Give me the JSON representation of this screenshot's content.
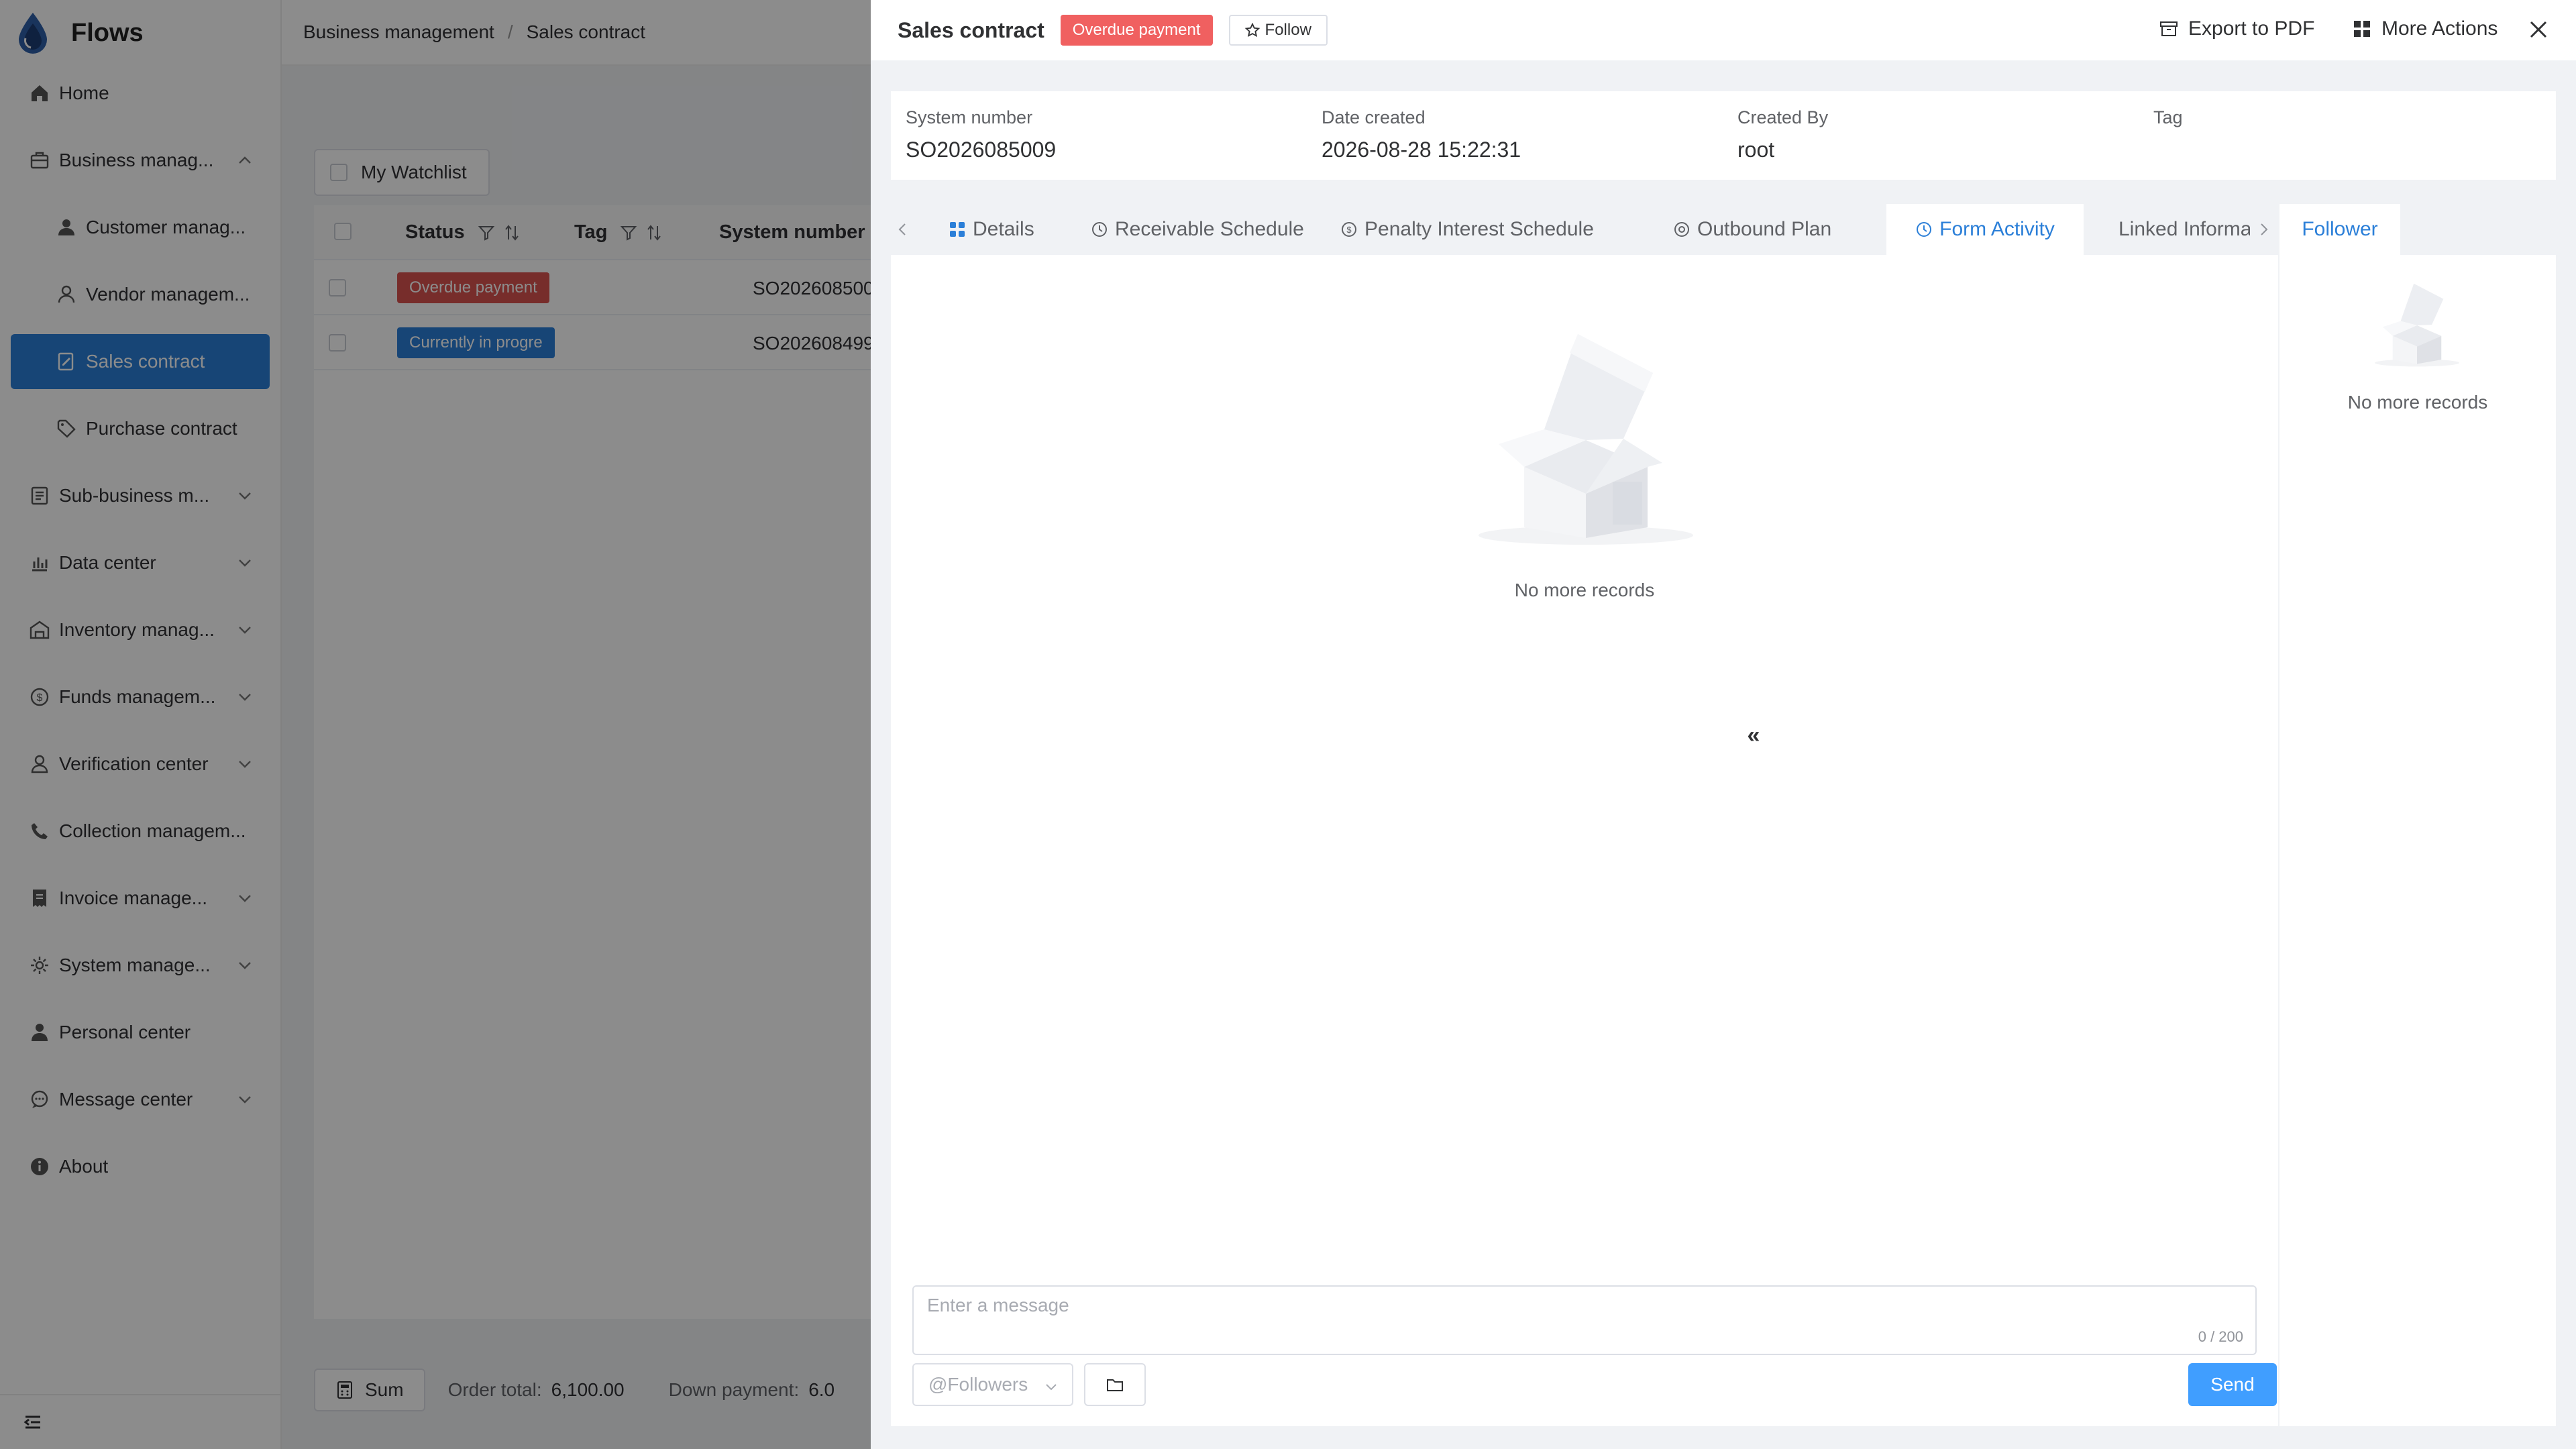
{
  "app": {
    "name": "Flows"
  },
  "sidebar": {
    "items": [
      {
        "label": "Home",
        "icon": "home-icon",
        "child": false,
        "active": false,
        "expandable": false
      },
      {
        "label": "Business manag...",
        "icon": "briefcase-icon",
        "child": false,
        "active": false,
        "expandable": true,
        "expanded": true
      },
      {
        "label": "Customer manag...",
        "icon": "user-icon",
        "child": true,
        "active": false,
        "expandable": false
      },
      {
        "label": "Vendor managem...",
        "icon": "user-outline-icon",
        "child": true,
        "active": false,
        "expandable": false
      },
      {
        "label": "Sales contract",
        "icon": "contract-edit-icon",
        "child": true,
        "active": true,
        "expandable": false
      },
      {
        "label": "Purchase contract",
        "icon": "tag-icon",
        "child": true,
        "active": false,
        "expandable": false
      },
      {
        "label": "Sub-business m...",
        "icon": "document-list-icon",
        "child": false,
        "active": false,
        "expandable": true
      },
      {
        "label": "Data center",
        "icon": "bar-chart-icon",
        "child": false,
        "active": false,
        "expandable": true
      },
      {
        "label": "Inventory manag...",
        "icon": "warehouse-icon",
        "child": false,
        "active": false,
        "expandable": true
      },
      {
        "label": "Funds managem...",
        "icon": "coin-icon",
        "child": false,
        "active": false,
        "expandable": true
      },
      {
        "label": "Verification center",
        "icon": "verify-user-icon",
        "child": false,
        "active": false,
        "expandable": true
      },
      {
        "label": "Collection managem...",
        "icon": "phone-icon",
        "child": false,
        "active": false,
        "expandable": false
      },
      {
        "label": "Invoice manage...",
        "icon": "invoice-icon",
        "child": false,
        "active": false,
        "expandable": true
      },
      {
        "label": "System manage...",
        "icon": "gear-icon",
        "child": false,
        "active": false,
        "expandable": true
      },
      {
        "label": "Personal center",
        "icon": "person-icon",
        "child": false,
        "active": false,
        "expandable": false
      },
      {
        "label": "Message center",
        "icon": "chat-icon",
        "child": false,
        "active": false,
        "expandable": true
      },
      {
        "label": "About",
        "icon": "info-icon",
        "child": false,
        "active": false,
        "expandable": false
      }
    ]
  },
  "breadcrumb": {
    "parent": "Business management",
    "separator": "/",
    "current": "Sales contract"
  },
  "list": {
    "watchlist_label": "My Watchlist",
    "columns": {
      "status": "Status",
      "tag": "Tag",
      "system_number": "System number"
    },
    "rows": [
      {
        "status": "Overdue payment",
        "status_color": "#d9534f",
        "system_number": "SO202608500"
      },
      {
        "status": "Currently in progre",
        "status_color": "#2b7fd8",
        "system_number": "SO202608499"
      }
    ],
    "footer": {
      "sum_label": "Sum",
      "order_total_label": "Order total:",
      "order_total_value": "6,100.00",
      "down_payment_label": "Down payment:",
      "down_payment_value": "6.0"
    }
  },
  "drawer": {
    "title": "Sales contract",
    "status_badge": "Overdue payment",
    "follow_label": "Follow",
    "export_label": "Export to PDF",
    "more_actions_label": "More Actions",
    "info": {
      "system_number_label": "System number",
      "system_number": "SO2026085009",
      "date_created_label": "Date created",
      "date_created": "2026-08-28 15:22:31",
      "created_by_label": "Created By",
      "created_by": "root",
      "tag_label": "Tag"
    },
    "tabs": [
      {
        "label": "Details",
        "icon": "grid-icon",
        "active": false
      },
      {
        "label": "Receivable Schedule",
        "icon": "clock-icon",
        "active": false
      },
      {
        "label": "Penalty Interest Schedule",
        "icon": "coin-icon",
        "active": false
      },
      {
        "label": "Outbound Plan",
        "icon": "target-icon",
        "active": false
      },
      {
        "label": "Form Activity",
        "icon": "clock-icon",
        "active": true
      },
      {
        "label": "Linked Informa",
        "icon": "grid-icon",
        "active": false
      }
    ],
    "empty_text": "No more records",
    "message": {
      "placeholder": "Enter a message",
      "counter": "0 / 200",
      "followers_label": "@Followers",
      "send_label": "Send"
    },
    "follower_panel": {
      "tab_label": "Follower",
      "empty_text": "No more records"
    },
    "colors": {
      "accent": "#2b7fd8",
      "danger": "#f06060",
      "send": "#409eff"
    }
  }
}
